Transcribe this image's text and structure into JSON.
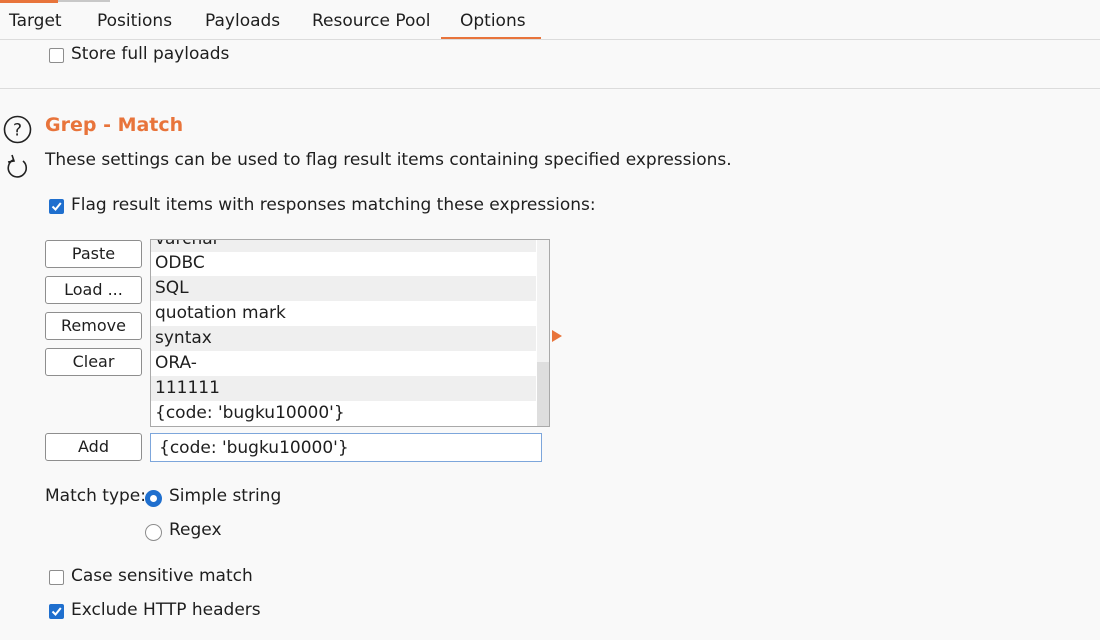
{
  "tabs": [
    "Target",
    "Positions",
    "Payloads",
    "Resource Pool",
    "Options"
  ],
  "store_full_payloads": {
    "label": "Store full payloads",
    "checked": false
  },
  "section": {
    "title": "Grep - Match",
    "description": "These settings can be used to flag result items containing specified expressions.",
    "icons": [
      "help-icon",
      "refresh-icon"
    ]
  },
  "flag_checkbox": {
    "label": "Flag result items with responses matching these expressions:",
    "checked": true
  },
  "buttons": {
    "paste": "Paste",
    "load": "Load ...",
    "remove": "Remove",
    "clear": "Clear",
    "add": "Add"
  },
  "expressions": [
    "varchar",
    "ODBC",
    "SQL",
    "quotation mark",
    "syntax",
    "ORA-",
    "111111",
    "{code: 'bugku10000'}"
  ],
  "add_input_value": "{code: 'bugku10000'}",
  "match_type": {
    "label": "Match type:",
    "options": [
      "Simple string",
      "Regex"
    ],
    "selected": "Simple string"
  },
  "case_sensitive": {
    "label": "Case sensitive match",
    "checked": false
  },
  "exclude_headers": {
    "label": "Exclude HTTP headers",
    "checked": true
  },
  "colors": {
    "accent": "#e8743b",
    "checkbox": "#1f6fce"
  }
}
